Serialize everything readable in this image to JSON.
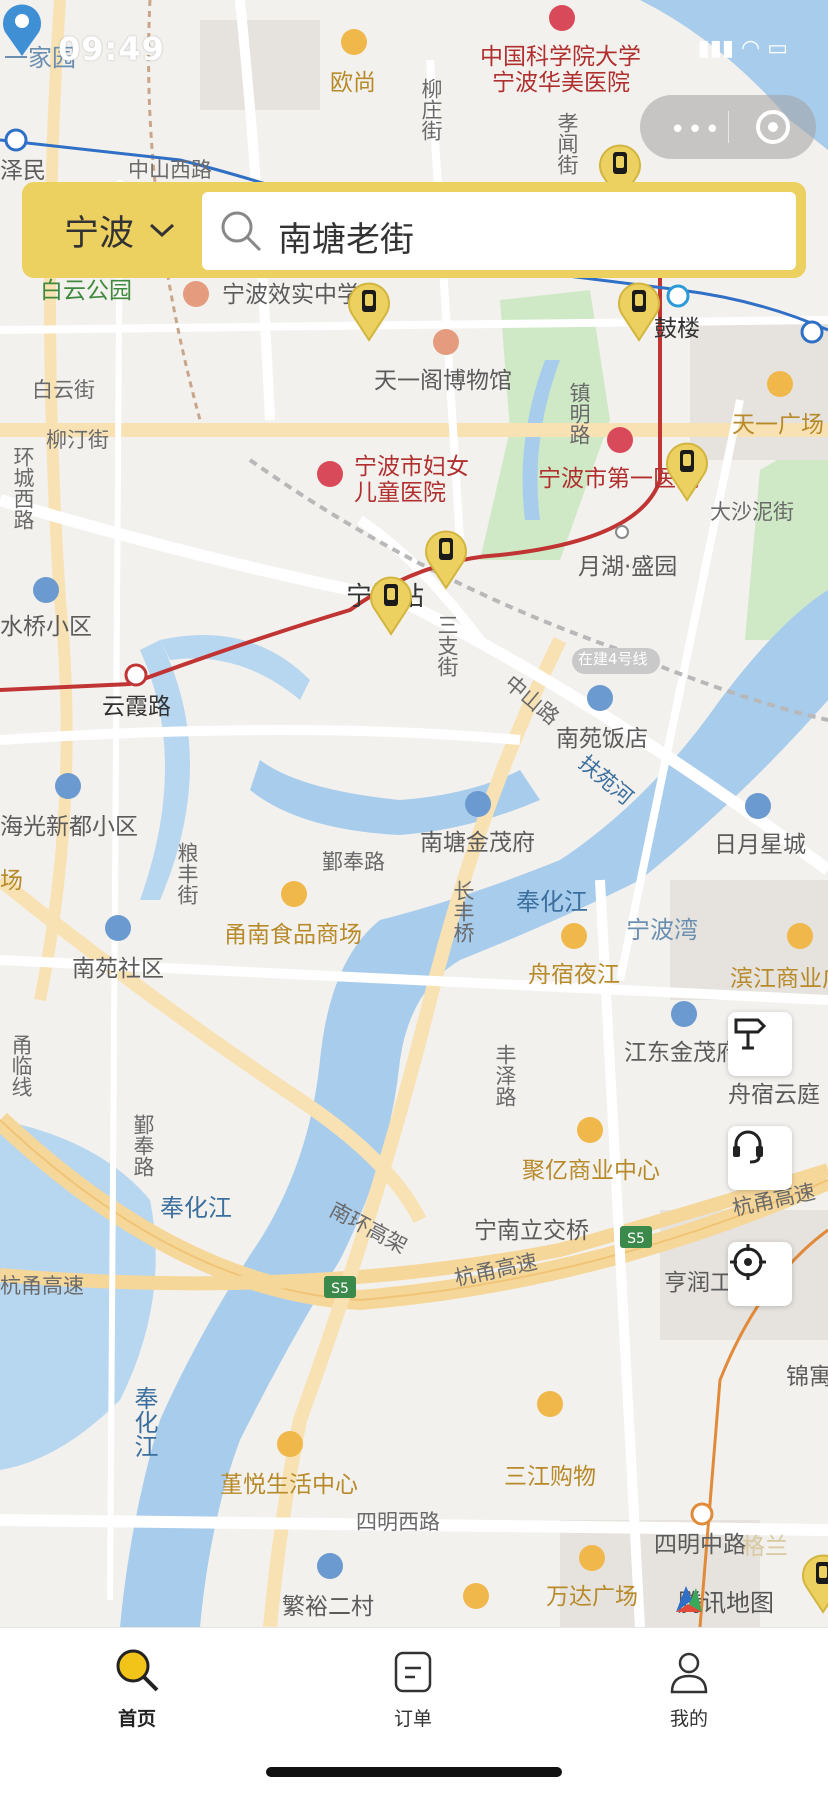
{
  "status_bar": {
    "time": "09:49"
  },
  "header": {
    "city": "宁波",
    "search_value": "南塘老街"
  },
  "map": {
    "labels": {
      "l01": "一家园",
      "l02": "欧尚",
      "l03": "中国科学院大学",
      "l04": "宁波华美医院",
      "l05": "柳庄街",
      "l06": "孝闻街",
      "l07": "泽民",
      "l08": "中山西路",
      "l09": "白云公园",
      "l10": "宁波效实中学",
      "l11": "鼓楼",
      "l12": "白云街",
      "l13": "天一阁博物馆",
      "l14": "天一广场",
      "l15": "柳汀街",
      "l16": "镇明路",
      "l17": "宁波市妇女",
      "l18": "儿童医院",
      "l19": "宁波市第一医院",
      "l20": "环城西路",
      "l21": "大沙泥街",
      "l22": "月湖·盛园",
      "l23": "宁波站",
      "l24": "水桥小区",
      "l25": "云霞路",
      "l26": "在建4号线",
      "l27": "南苑饭店",
      "l28": "海光新都小区",
      "l29": "南塘金茂府",
      "l30": "日月星城",
      "l31": "鄞奉路",
      "l32": "奉化江",
      "l33": "宁波湾",
      "l34": "甬南食品商场",
      "l35": "南苑社区",
      "l36": "舟宿夜江",
      "l37": "滨江商业广场",
      "l38": "江东金茂府",
      "l39": "舟宿云庭",
      "l40": "聚亿商业中心",
      "l41": "奉化江",
      "l42": "宁南立交桥",
      "l43": "杭甬高速",
      "l44": "亨润工",
      "l45": "杭甬高速",
      "l46": "南环高架",
      "l47": "锦寓",
      "l48": "奉化江",
      "l49": "堇悦生活中心",
      "l50": "三江购物",
      "l51": "四明西路",
      "l52": "四明中路",
      "l53": "繁裕二村",
      "l54": "万达广场",
      "l55": "格兰",
      "l56": "长丰桥",
      "l57": "丰泽路",
      "l58": "粮丰街",
      "l59": "甬临线",
      "l60": "鄞奉路",
      "l61": "扶苑河",
      "l62": "三支街",
      "l63": "中山路",
      "l64": "场",
      "l65": "杭甬高速",
      "l66": "S5",
      "l67": "S5"
    },
    "watermark": "腾讯地图"
  },
  "controls": {
    "route": "signpost-icon",
    "service": "headset-icon",
    "locate": "crosshair-icon"
  },
  "tabbar": {
    "tabs": [
      {
        "label": "首页",
        "icon": "search-icon"
      },
      {
        "label": "订单",
        "icon": "order-icon"
      },
      {
        "label": "我的",
        "icon": "user-icon"
      }
    ]
  },
  "colors": {
    "accent": "#ecd060",
    "metro": "#c03534",
    "metro_blue": "#2f6fc5",
    "water": "#a8ccec"
  }
}
